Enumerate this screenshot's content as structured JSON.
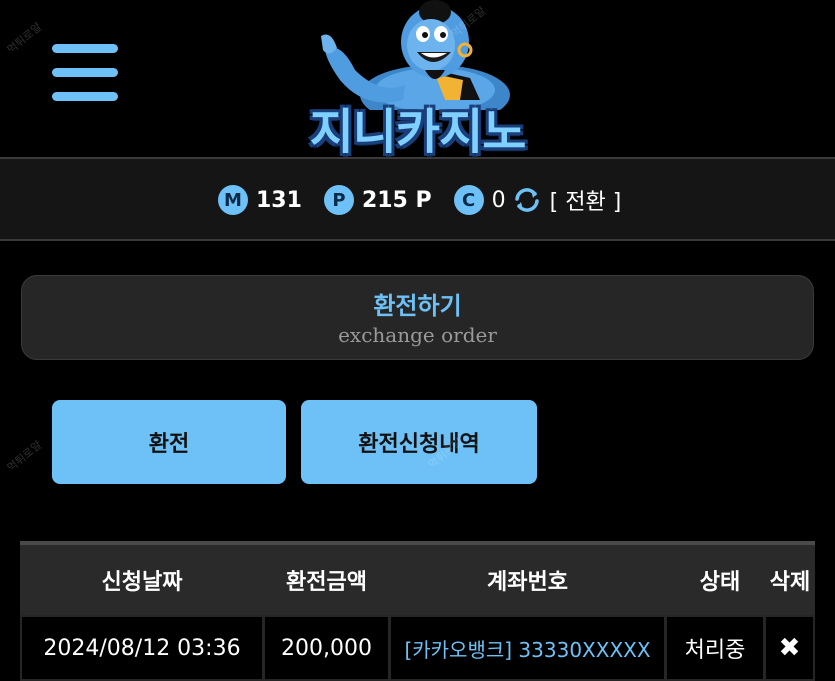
{
  "header": {
    "menu_icon": "hamburger-menu-icon",
    "logo_text": "지니카지노"
  },
  "balance": {
    "money_badge": "M",
    "money_value": "131",
    "point_badge": "P",
    "point_value": "215 P",
    "coin_badge": "C",
    "coin_value": "0",
    "refresh_icon": "refresh-icon",
    "convert_label": "[ 전환 ]"
  },
  "exchange": {
    "title": "환전하기",
    "subtitle": "exchange order"
  },
  "buttons": {
    "exchange_label": "환전",
    "history_label": "환전신청내역"
  },
  "table": {
    "headers": [
      "신청날짜",
      "환전금액",
      "계좌번호",
      "상태",
      "삭제"
    ],
    "rows": [
      {
        "date": "2024/08/12 03:36",
        "amount": "200,000",
        "account": "[카카오뱅크] 33330XXXXX",
        "status": "처리중",
        "delete": "✖"
      }
    ]
  },
  "watermark": "먹튀로얄",
  "colors": {
    "accent": "#6ec1f7",
    "background": "#000000",
    "panel": "#262626"
  }
}
